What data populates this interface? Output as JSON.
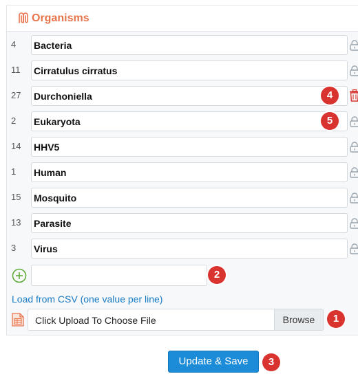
{
  "panel": {
    "title": "Organisms",
    "title_color": "#e8744c",
    "header_icon": "paperclip-icon"
  },
  "organisms": [
    {
      "count": "4",
      "name": "Bacteria",
      "action_icon": "lock-icon"
    },
    {
      "count": "11",
      "name": "Cirratulus cirratus",
      "action_icon": "lock-icon"
    },
    {
      "count": "27",
      "name": "Durchoniella",
      "action_icon": "trash-icon"
    },
    {
      "count": "2",
      "name": "Eukaryota",
      "action_icon": "lock-icon"
    },
    {
      "count": "14",
      "name": "HHV5",
      "action_icon": "lock-icon"
    },
    {
      "count": "1",
      "name": "Human",
      "action_icon": "lock-icon"
    },
    {
      "count": "15",
      "name": "Mosquito",
      "action_icon": "lock-icon"
    },
    {
      "count": "13",
      "name": "Parasite",
      "action_icon": "lock-icon"
    },
    {
      "count": "3",
      "name": "Virus",
      "action_icon": "lock-icon"
    }
  ],
  "add": {
    "icon": "plus-circle-icon",
    "value": "",
    "placeholder": ""
  },
  "csv": {
    "link_label": "Load from CSV (one value per line)",
    "file_placeholder": "Click Upload To Choose File",
    "browse_label": "Browse",
    "icon": "csv-file-icon"
  },
  "actions": {
    "save_label": "Update & Save",
    "save_color": "#1c8cd9"
  },
  "callouts": {
    "c1": "1",
    "c2": "2",
    "c3": "3",
    "c4": "4",
    "c5": "5",
    "color": "#d9332f"
  }
}
